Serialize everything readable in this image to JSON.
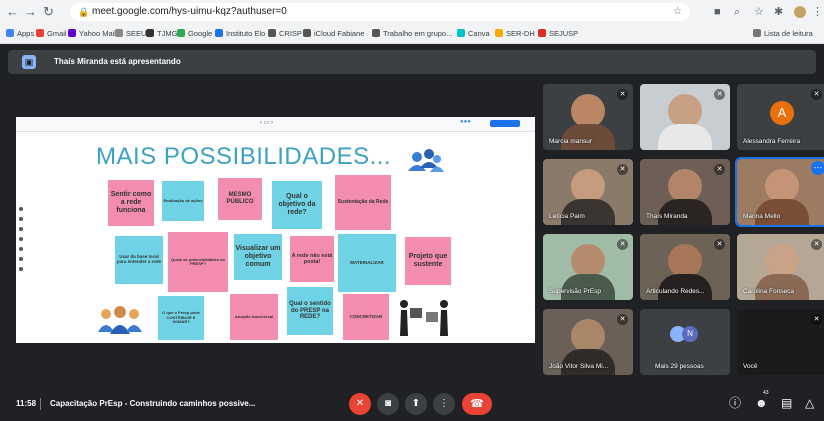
{
  "browser": {
    "url": "meet.google.com/hys-uimu-kqz?authuser=0",
    "bookmarks": [
      "Apps",
      "Gmail",
      "Yahoo Mail",
      "SEEU",
      "TJMG",
      "Google",
      "Instituto Elo",
      "CRISP",
      "iCloud Fabiane",
      "Trabalho em grupo...",
      "Canva",
      "SER-DH",
      "SEJUSP"
    ],
    "reading_list": "Lista de leitura"
  },
  "banner": {
    "text": "Thaís Miranda está apresentando"
  },
  "slide": {
    "title": "MAIS POSSIBILIDADES...",
    "notes": [
      "Sentir como a rede funciona",
      "Realização de ações",
      "MESMO PÚBLICO",
      "Qual o objetivo da rede?",
      "Sustentação da Rede",
      "Usar da base local para entender a rede",
      "Quais as potencialidades do PRESP?",
      "Visualizar um objetivo comum",
      "A rede não está posta!",
      "MATERIALIZAR",
      "Projeto que sustente",
      "O que o Presp pode CONTRIBUIR E SOMAR?",
      "Atuação transversal",
      "Qual o sentido do PRESP na REDE?",
      "CONCRETIZAR"
    ]
  },
  "participants": [
    {
      "name": "Marcia mansur"
    },
    {
      "name": ""
    },
    {
      "name": "Alessandra Ferreira",
      "initial": "A"
    },
    {
      "name": "Letícia Paim"
    },
    {
      "name": "Thaís Miranda"
    },
    {
      "name": "Marina Mello"
    },
    {
      "name": "Supervisão PrEsp"
    },
    {
      "name": "Articulando Redes..."
    },
    {
      "name": "Carolina Fonseca"
    },
    {
      "name": "João Vitor Silva Mi..."
    },
    {
      "name": "Mais 29 pessoas",
      "initial": "N"
    },
    {
      "name": "Você"
    }
  ],
  "bottom": {
    "time": "11:58",
    "meeting_title": "Capacitação PrEsp - Construindo caminhos possive...",
    "people_count": "43"
  },
  "colors": {
    "accent": "#1a73e8",
    "danger": "#ea4335",
    "note_pink": "#f28cb1",
    "note_cyan": "#6fd3e5",
    "title": "#3ba2c1"
  }
}
